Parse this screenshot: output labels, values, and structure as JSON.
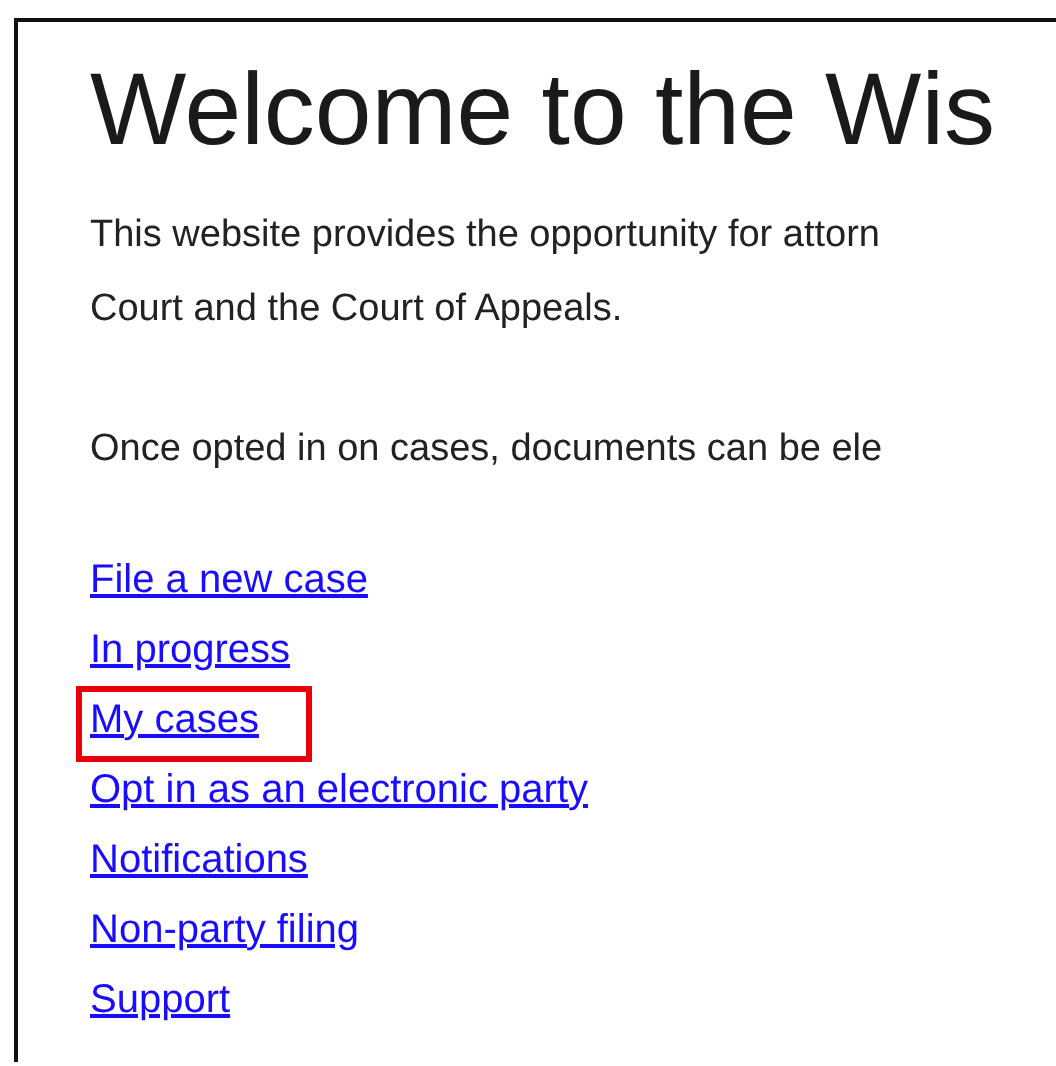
{
  "heading": "Welcome to the Wis",
  "paragraphs": [
    "This website provides the opportunity for attorn",
    "Court and the Court of Appeals.",
    "Once opted in on cases, documents can be ele"
  ],
  "links": [
    {
      "label": "File a new case",
      "highlighted": false
    },
    {
      "label": "In progress",
      "highlighted": false
    },
    {
      "label": "My cases",
      "highlighted": true
    },
    {
      "label": "Opt in as an electronic party",
      "highlighted": false
    },
    {
      "label": "Notifications",
      "highlighted": false
    },
    {
      "label": "Non-party filing",
      "highlighted": false
    },
    {
      "label": "Support",
      "highlighted": false
    }
  ]
}
